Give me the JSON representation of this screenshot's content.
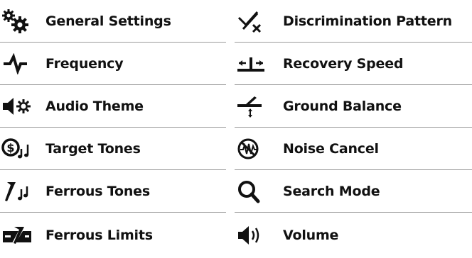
{
  "left_items": [
    {
      "label": "General Settings",
      "icon": "gears-icon"
    },
    {
      "label": "Frequency",
      "icon": "waveform-icon"
    },
    {
      "label": "Audio Theme",
      "icon": "speaker-gear-icon"
    },
    {
      "label": "Target Tones",
      "icon": "coin-note-icon"
    },
    {
      "label": "Ferrous Tones",
      "icon": "nail-note-icon"
    },
    {
      "label": "Ferrous Limits",
      "icon": "ferrous-limits-icon"
    }
  ],
  "right_items": [
    {
      "label": "Discrimination Pattern",
      "icon": "discrimination-icon"
    },
    {
      "label": "Recovery Speed",
      "icon": "recovery-speed-icon"
    },
    {
      "label": "Ground Balance",
      "icon": "ground-balance-icon"
    },
    {
      "label": "Noise Cancel",
      "icon": "noise-cancel-icon"
    },
    {
      "label": "Search Mode",
      "icon": "magnifier-icon"
    },
    {
      "label": "Volume",
      "icon": "volume-icon"
    }
  ],
  "colors": {
    "text": "#111111",
    "divider": "#9a9a9a",
    "background": "#ffffff"
  }
}
